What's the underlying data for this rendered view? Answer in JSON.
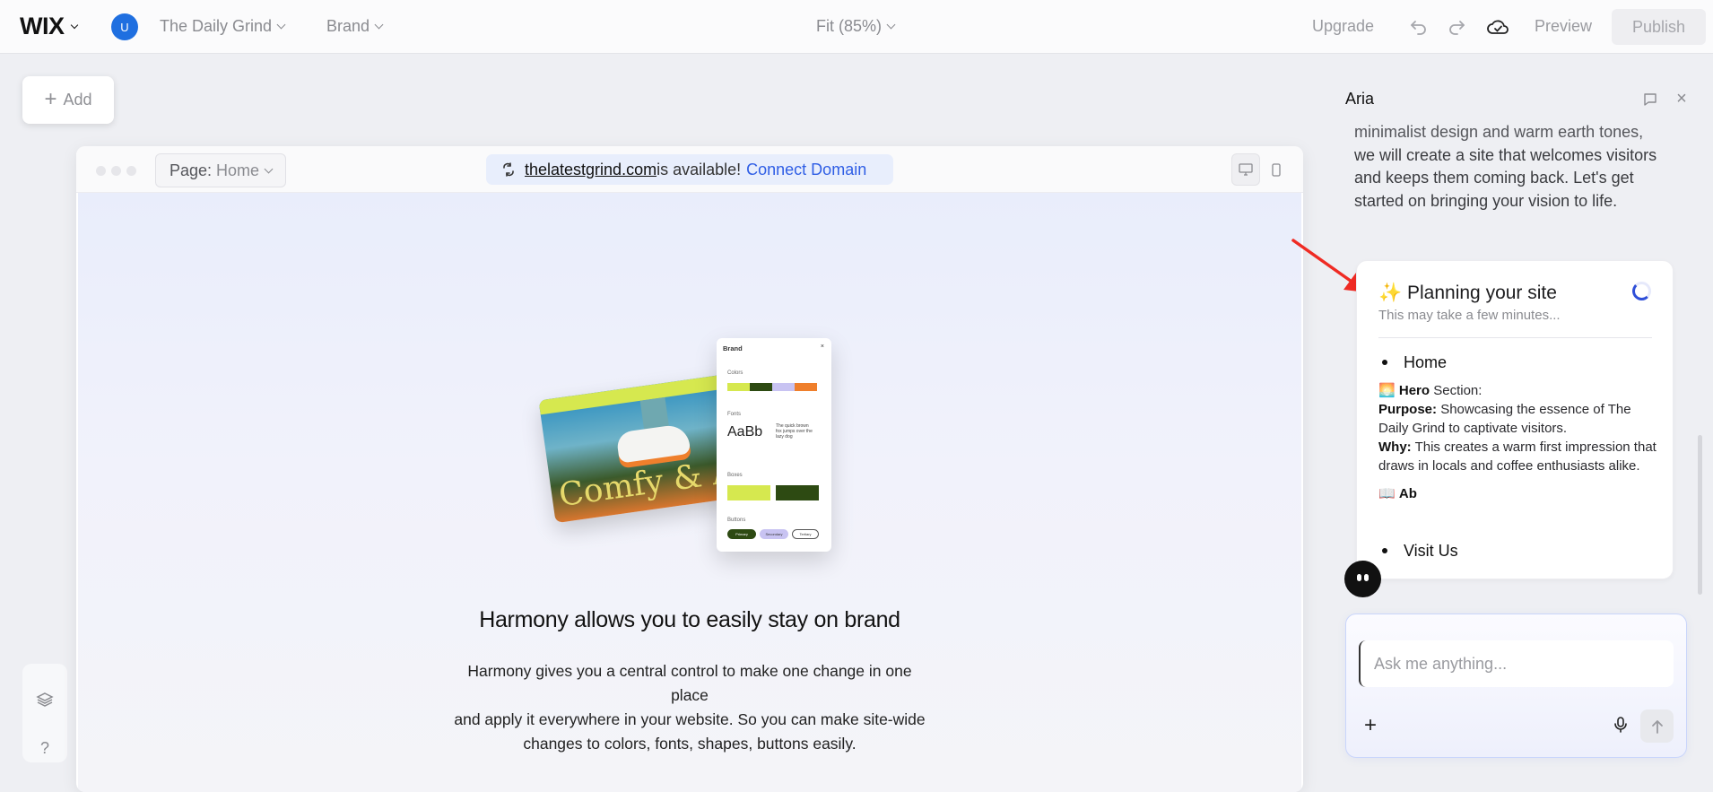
{
  "topbar": {
    "logo": "WIX",
    "avatar_initial": "U",
    "site_name": "The Daily Grind",
    "brand_menu": "Brand",
    "zoom": "Fit (85%)",
    "upgrade": "Upgrade",
    "preview": "Preview",
    "publish": "Publish"
  },
  "canvas": {
    "add_label": "Add",
    "page_label": "Page:",
    "page_value": "Home",
    "domain": "thelatestgrind.com",
    "domain_status": "is available!",
    "connect_domain": "Connect Domain",
    "hero_title": "Harmony allows you to easily stay on brand",
    "hero_desc_1": "Harmony gives you a central control to make one change in one place",
    "hero_desc_2": "and apply it  everywhere in your website. So you can make site-wide",
    "hero_desc_3": "changes to colors, fonts, shapes, buttons easily."
  },
  "illustration": {
    "photo_text": "Comfy & A",
    "panel_title": "Brand",
    "colors_label": "Colors",
    "fonts_label": "Fonts",
    "font_sample": "AaBb",
    "font_pangram": "The quick brown fox jumps over the lazy dog",
    "boxes_label": "Boxes",
    "buttons_label": "Buttons",
    "btn_primary": "Primary",
    "btn_secondary": "Secondary",
    "btn_tertiary": "Tertiary",
    "swatches": [
      "#d6e84f",
      "#2d4a12",
      "#c8c3f2",
      "#ef7f2c"
    ]
  },
  "aria": {
    "title": "Aria",
    "message_line1": "minimalist design and warm earth tones,",
    "message_line2": "we will create a site that welcomes visitors",
    "message_line3": "and keeps them coming back. Let's get",
    "message_line4": "started on bringing your vision to life.",
    "plan": {
      "emoji": "✨",
      "title": "Planning your site",
      "subtitle": "This may take a few minutes...",
      "page_home": "Home",
      "hero_emoji": "🌅",
      "hero_label": "Hero",
      "hero_suffix": "Section:",
      "purpose_label": "Purpose:",
      "purpose_text": "Showcasing the essence of The Daily Grind to captivate visitors.",
      "why_label": "Why:",
      "why_text": "This creates a warm first impression that draws in locals and coffee enthusiasts alike.",
      "about_emoji": "📖",
      "about_partial": "Ab",
      "page_visit": "Visit Us"
    },
    "input_placeholder": "Ask me anything..."
  },
  "colors": {
    "accent": "#2f5ee5",
    "avatar": "#1f6fe0",
    "annotation_arrow": "#ef2b24"
  }
}
